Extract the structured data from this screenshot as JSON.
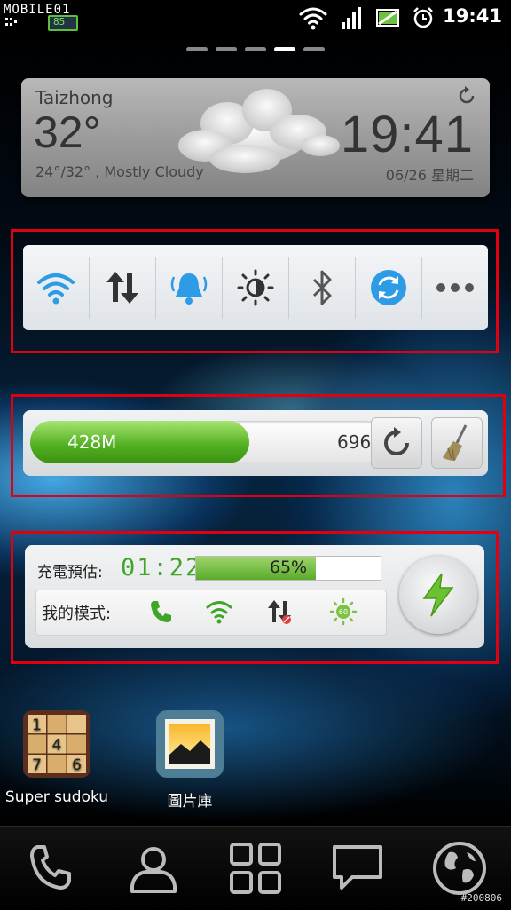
{
  "status_bar": {
    "brand": "MOBILE01",
    "battery_level": "85",
    "time": "19:41",
    "icons": [
      "wifi-icon",
      "signal-icon",
      "battery-icon",
      "alarm-icon"
    ]
  },
  "home_pages": {
    "count": 5,
    "active_index": 3
  },
  "weather": {
    "city": "Taizhong",
    "temperature": "32°",
    "description": "24°/32° , Mostly Cloudy",
    "time": "19:41",
    "date": "06/26  星期二"
  },
  "toggles": [
    {
      "name": "wifi",
      "state": "on",
      "icon": "wifi-icon"
    },
    {
      "name": "mobile-data",
      "state": "off",
      "icon": "data-arrows-icon"
    },
    {
      "name": "sound",
      "state": "on",
      "icon": "bell-icon"
    },
    {
      "name": "brightness",
      "state": "off",
      "icon": "brightness-icon"
    },
    {
      "name": "bluetooth",
      "state": "off",
      "icon": "bluetooth-icon"
    },
    {
      "name": "sync",
      "state": "on",
      "icon": "sync-icon"
    },
    {
      "name": "more",
      "state": "off",
      "icon": "more-icon"
    }
  ],
  "memory": {
    "used": "428M",
    "total": "696M",
    "used_fraction": 0.615
  },
  "battery_widget": {
    "charge_label": "充電預估:",
    "charge_time": "01:22",
    "percent_text": "65%",
    "percent": 65,
    "mode_label": "我的模式:",
    "mode_icons": [
      "phone-icon",
      "wifi-icon",
      "data-off-icon",
      "brightness-60-icon"
    ]
  },
  "apps": [
    {
      "label": "Super sudoku",
      "icon": "sudoku-icon",
      "grid": [
        "1",
        "",
        "",
        "",
        "4",
        "",
        "7",
        "",
        "6"
      ]
    },
    {
      "label": "圖片庫",
      "icon": "gallery-icon"
    }
  ],
  "dock": [
    {
      "name": "phone",
      "icon": "phone-icon"
    },
    {
      "name": "contacts",
      "icon": "contacts-icon"
    },
    {
      "name": "apps",
      "icon": "app-grid-icon"
    },
    {
      "name": "messages",
      "icon": "message-icon"
    },
    {
      "name": "browser",
      "icon": "globe-icon"
    }
  ],
  "watermark": "#200806",
  "colors": {
    "highlight_box": "#e00010",
    "toggle_active": "#2e9be6",
    "progress_green": "#4fae1f"
  }
}
